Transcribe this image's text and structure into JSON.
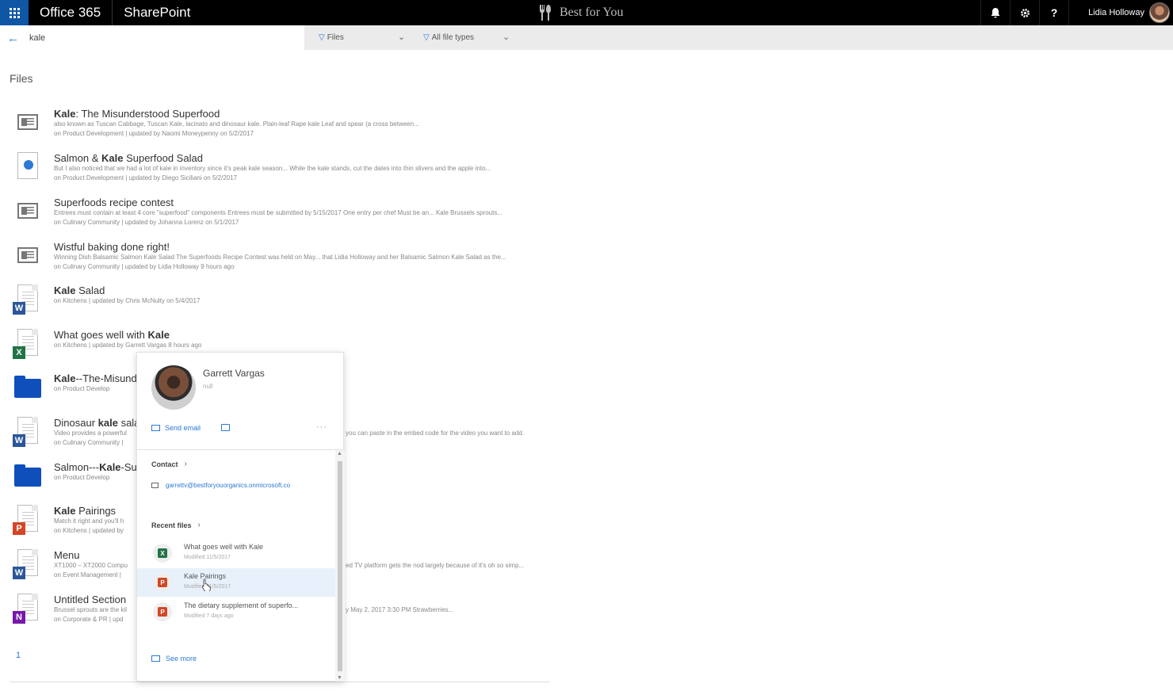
{
  "suite": {
    "app_name": "Office 365",
    "product": "SharePoint",
    "site_name": "Best for You",
    "user_name": "Lidia Holloway"
  },
  "search": {
    "query": "kale",
    "filter_scope": "Files",
    "filter_type": "All file types"
  },
  "results_heading": "Files",
  "results": [
    {
      "icon": "news-icon",
      "title_bold": "Kale",
      "title_rest": ": The Misunderstood Superfood",
      "snippet": "also known as Tuscan Cabbage, Tuscan Kale, lacinato and dinosaur kale. Plain-leaf Rape kale Leaf and spear (a cross between...",
      "meta": "on Product Development | updated by Naomi Moneypenny on 5/2/2017"
    },
    {
      "icon": "sway-icon",
      "title_pre": "Salmon & ",
      "title_bold": "Kale",
      "title_rest": " Superfood Salad",
      "snippet": "But I also noticed that we had a lot of kale in inventory since it's peak kale season... While the kale stands, cut the dates into thin slivers and the apple into...",
      "meta": "on Product Development | updated by Diego Siciliani on 5/2/2017"
    },
    {
      "icon": "news-icon",
      "title_rest": "Superfoods recipe contest",
      "snippet": "Entrees must contain at least 4 core \"superfood\" components Entrees must be submitted by 5/15/2017 One entry per chef Must be an... Kale Brussels sprouts...",
      "meta": "on Culinary Community | updated by Johanna Lorenz on 5/1/2017"
    },
    {
      "icon": "news-icon",
      "title_rest": "Wistful baking done right!",
      "snippet": "Winning Dish Balsamic Salmon Kale Salad The Superfoods Recipe Contest was held on May... that Lidia Holloway and her Balsamic Salmon Kale Salad as the...",
      "meta": "on Culinary Community | updated by Lidia Holloway 9 hours ago"
    },
    {
      "icon": "word-icon",
      "title_bold": "Kale",
      "title_rest": " Salad",
      "meta": "on Kitchens | updated by Chris McNulty on 5/4/2017"
    },
    {
      "icon": "excel-icon",
      "title_pre": "What goes well with ",
      "title_bold": "Kale",
      "meta": "on Kitchens | updated by Garrett Vargas 8 hours ago"
    },
    {
      "icon": "folder-icon",
      "title_bold": "Kale",
      "title_rest": "--The-Misund",
      "meta": "on Product Develop"
    },
    {
      "icon": "word-icon",
      "title_pre": "Dinosaur ",
      "title_bold": "kale",
      "title_rest": " sala",
      "snippet": "Video provides a powerful",
      "snippet_right": "you can paste in the embed code for the video you want to add.",
      "meta": "on Culinary Community |"
    },
    {
      "icon": "folder-icon",
      "title_pre": "Salmon---",
      "title_bold": "Kale",
      "title_rest": "-Su",
      "meta": "on Product Develop"
    },
    {
      "icon": "powerpoint-icon",
      "title_bold": "Kale",
      "title_rest": " Pairings",
      "snippet": "Match it right and you'll h",
      "meta": "on Kitchens | updated by"
    },
    {
      "icon": "word-icon",
      "title_rest": "Menu",
      "snippet": "XT1000 – XT2000 Compu",
      "snippet_right": "ed TV platform gets the nod largely because of it's oh so simp...",
      "meta": "on Event Management |"
    },
    {
      "icon": "onenote-icon",
      "title_rest": "Untitled Section",
      "snippet": "Brussel sprouts are the kil",
      "snippet_right": "y May 2, 2017 3:30 PM Strawberries...",
      "meta": "on Corporate & PR | upd"
    }
  ],
  "pagination": {
    "current": "1"
  },
  "profile_card": {
    "name": "Garrett Vargas",
    "subtitle": "null",
    "send_email": "Send email",
    "contact_heading": "Contact",
    "email": "garrettv@bestforyouorganics.onmicrosoft.co",
    "recent_files_heading": "Recent files",
    "recent_files": [
      {
        "title": "What goes well with Kale",
        "modified": "Modified 11/5/2017",
        "type": "excel"
      },
      {
        "title": "Kale Pairings",
        "modified": "Modified 11/5/2017",
        "type": "powerpoint"
      },
      {
        "title": "The dietary supplement of superfo...",
        "modified": "Modified 7 days ago",
        "type": "powerpoint"
      }
    ],
    "see_more": "See more"
  },
  "colors": {
    "suite_bar": "#000000",
    "waffle": "#0f56a5",
    "accent": "#2b79d4",
    "word": "#2b579a",
    "excel": "#217346",
    "powerpoint": "#d24726",
    "onenote": "#7719aa",
    "folder": "#0f4fbb"
  }
}
